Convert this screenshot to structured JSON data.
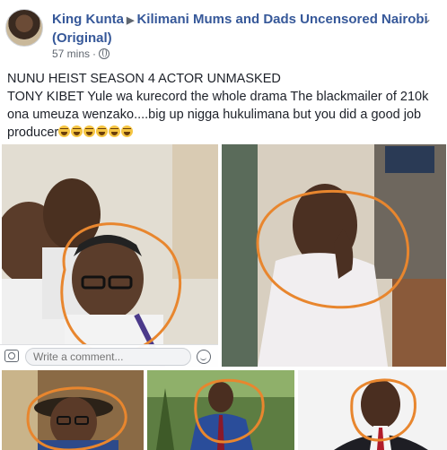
{
  "post": {
    "author": "King Kunta",
    "group": "Kilimani Mums and Dads Uncensored Nairobi (Original)",
    "time": "57 mins",
    "separator": "·",
    "headline": "NUNU HEIST SEASON 4 ACTOR UNMASKED",
    "body": "TONY KIBET Yule wa kurecord the whole drama The blackmailer of 210k ona umeuza wenzako....big up nigga hukulimana but you did a good job producer",
    "emoji_count": 6
  },
  "comment": {
    "placeholder": "Write a comment..."
  },
  "icons": {
    "arrow": "right-triangle-icon",
    "privacy": "globe-icon",
    "menu": "chevron-down-icon",
    "camera": "camera-icon",
    "emoji": "smile-icon",
    "laugh": "laughing-emoji-icon"
  },
  "colors": {
    "link": "#365899",
    "text": "#1d2129",
    "meta": "#606770",
    "circle_annotation": "#e8862e"
  }
}
